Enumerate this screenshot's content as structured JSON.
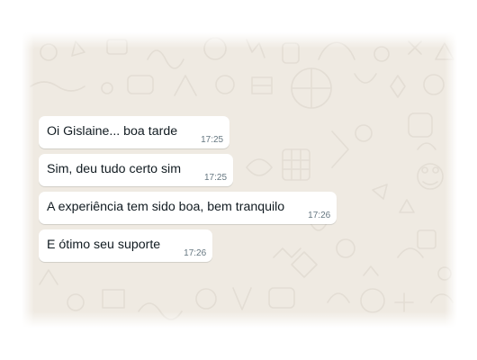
{
  "chat": {
    "messages": [
      {
        "text": "Oi Gislaine... boa tarde",
        "time": "17:25"
      },
      {
        "text": "Sim, deu tudo certo sim",
        "time": "17:25"
      },
      {
        "text": "A experiência tem sido boa, bem tranquilo",
        "time": "17:26"
      },
      {
        "text": "E ótimo seu suporte",
        "time": "17:26"
      }
    ]
  },
  "colors": {
    "wallpaper": "#efeae2",
    "bubble": "#ffffff",
    "text": "#111b21",
    "timestamp": "#667781"
  }
}
